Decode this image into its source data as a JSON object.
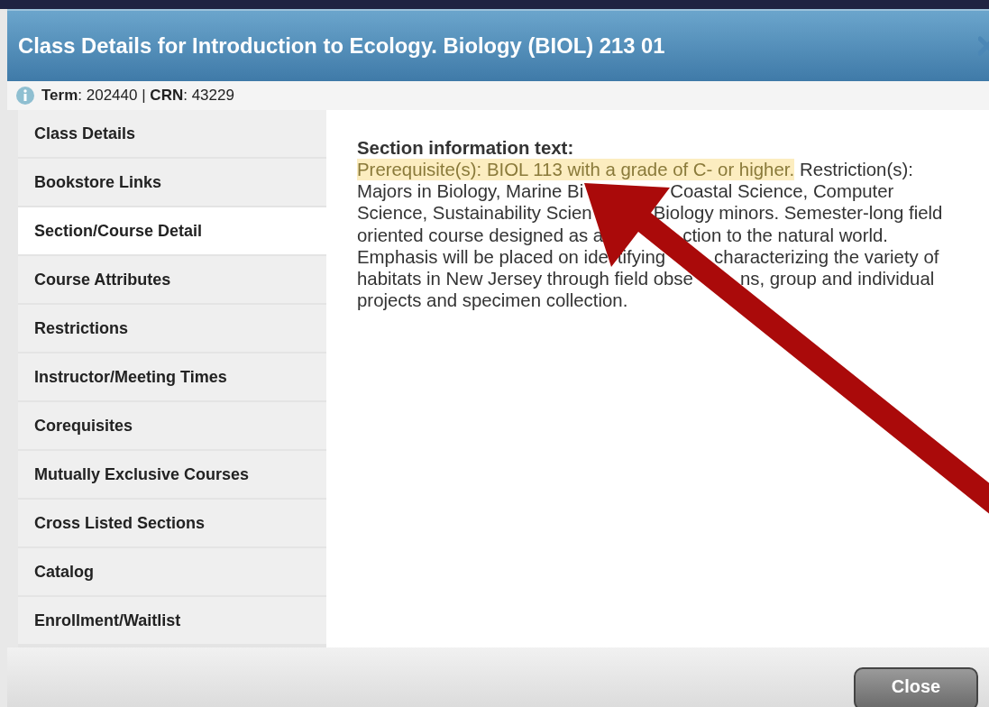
{
  "dialog": {
    "title": "Class Details for Introduction to Ecology. Biology (BIOL) 213 01"
  },
  "info": "**Term**: 202440 | **CRN**: 43229",
  "sidebar": {
    "items": [
      {
        "label": "Class Details",
        "selected": false
      },
      {
        "label": "Bookstore Links",
        "selected": false
      },
      {
        "label": "Section/Course Detail",
        "selected": true
      },
      {
        "label": "Course Attributes",
        "selected": false
      },
      {
        "label": "Restrictions",
        "selected": false
      },
      {
        "label": "Instructor/Meeting Times",
        "selected": false
      },
      {
        "label": "Corequisites",
        "selected": false
      },
      {
        "label": "Mutually Exclusive Courses",
        "selected": false
      },
      {
        "label": "Cross Listed Sections",
        "selected": false
      },
      {
        "label": "Catalog",
        "selected": false
      },
      {
        "label": "Enrollment/Waitlist",
        "selected": false
      }
    ]
  },
  "content": {
    "heading": "Section information text:",
    "lines": [
      [
        {
          "text": "Prerequisite(s): BIOL 113 with a grade of C- or higher.",
          "highlighted": true
        },
        {
          "text": "Restriction(s):",
          "highlighted": false
        }
      ],
      [
        {
          "text": "Majors in Biology, Marine Bi",
          "highlighted": false
        },
        {
          "text": "Coastal Science, Computer",
          "highlighted": false
        }
      ],
      [
        {
          "text": "Science, Sustainability Scien",
          "highlighted": false
        },
        {
          "text": "Biology minors. Semester-long field",
          "highlighted": false
        }
      ],
      [
        {
          "text": "oriented course designed as a",
          "highlighted": false
        },
        {
          "text": "ction to the natural world.",
          "highlighted": false
        }
      ],
      [
        {
          "text": "Emphasis will be placed on ide",
          "highlighted": false
        },
        {
          "text": "tifying",
          "highlighted": false
        },
        {
          "text": "characterizing the variety of",
          "highlighted": false
        }
      ],
      [
        {
          "text": "habitats in New Jersey through field obse",
          "highlighted": false
        },
        {
          "text": "ns, group and individual",
          "highlighted": false
        }
      ],
      [
        {
          "text": "projects and specimen collection.",
          "highlighted": false
        }
      ]
    ]
  },
  "buttons": [
    {
      "label": "Close"
    }
  ]
}
